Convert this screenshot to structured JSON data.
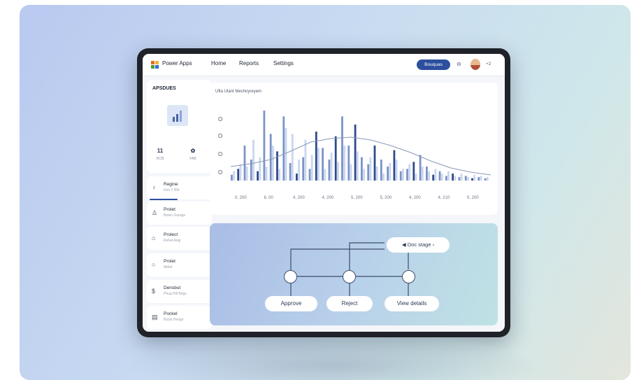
{
  "app": {
    "name": "Power Apps"
  },
  "nav": {
    "items": [
      "Home",
      "Reports",
      "Settings"
    ]
  },
  "topbar": {
    "primary_button": "Bouquas",
    "user_badge": "+2"
  },
  "sidebar": {
    "title": "APSDUES",
    "stats": [
      {
        "value": "11",
        "label": "RCB"
      },
      {
        "value": "✿",
        "label": "FAB"
      }
    ],
    "items": [
      {
        "title": "Regine",
        "sub": "Don 2 RM",
        "icon": "user-pin-icon"
      },
      {
        "title": "Prolet",
        "sub": "Beten Garage",
        "icon": "user-icon"
      },
      {
        "title": "Prolect",
        "sub": "Rohat Angi",
        "icon": "home-icon"
      },
      {
        "title": "Prolet",
        "sub": "Akbol",
        "icon": "circle-icon"
      },
      {
        "title": "Densbut",
        "sub": "Phug Rill Brigs",
        "icon": "dollar-icon"
      },
      {
        "title": "Pockel",
        "sub": "Bosla Hesgo",
        "icon": "document-icon"
      }
    ]
  },
  "chart": {
    "title": "Ufta Ulant Mechnyreyem"
  },
  "chart_data": {
    "type": "bar",
    "title": "Ufta Ulant Mechnyreyem",
    "y_tick_labels": [
      "O",
      "O",
      "O",
      "O"
    ],
    "x_tick_labels": [
      "0, 200",
      "6, 00",
      "4, 200",
      "4, 200",
      "5, 200",
      "5, 200",
      "4, 200",
      "4, 210",
      "5, 200"
    ],
    "series": [
      {
        "values": [
          5,
          10,
          30,
          18,
          8,
          60,
          40,
          25,
          55,
          15,
          6,
          20,
          10,
          42,
          28,
          18,
          38,
          55,
          30,
          48,
          20,
          14,
          30,
          18,
          12,
          26,
          8,
          10,
          16,
          22,
          12,
          5,
          8,
          4,
          6,
          3,
          4,
          2,
          3,
          2
        ]
      },
      {
        "values": [
          8,
          14,
          12,
          35,
          20,
          12,
          30,
          10,
          45,
          40,
          18,
          35,
          22,
          28,
          10,
          24,
          16,
          30,
          14,
          25,
          10,
          20,
          12,
          6,
          15,
          18,
          10,
          14,
          6,
          12,
          8,
          10,
          6,
          8,
          4,
          6,
          3,
          5,
          4,
          3
        ]
      }
    ],
    "trend": [
      0.2,
      0.24,
      0.3,
      0.42,
      0.55,
      0.6,
      0.62,
      0.58,
      0.5,
      0.4,
      0.28,
      0.18,
      0.12,
      0.08
    ],
    "colors": {
      "primary": "#4c66a8",
      "secondary": "#c9d6ef"
    }
  },
  "flow": {
    "callout": "Doc stage",
    "buttons": [
      "Approve",
      "Reject",
      "View details"
    ]
  }
}
